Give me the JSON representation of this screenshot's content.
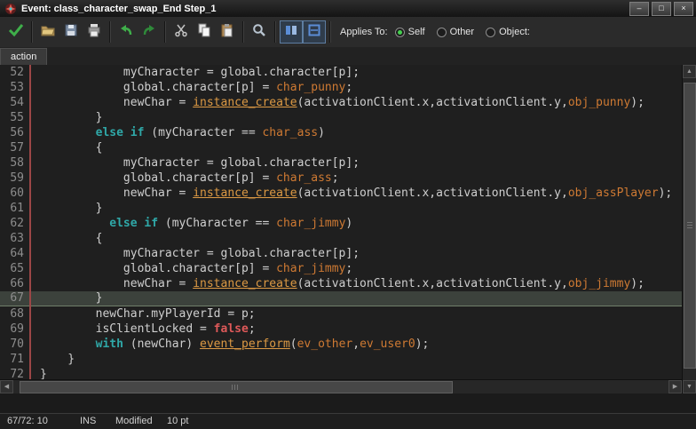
{
  "window": {
    "title": "Event: class_character_swap_End Step_1"
  },
  "glyphs": {
    "minimize": "–",
    "maximize": "□",
    "close": "×",
    "up": "▲",
    "down": "▼",
    "left": "◀",
    "right": "▶"
  },
  "toolbar": {
    "buttons": [
      "ok",
      "open",
      "save",
      "print",
      "undo",
      "redo",
      "cut",
      "copy",
      "paste",
      "search",
      "toggle-1",
      "toggle-2"
    ],
    "applies_to_label": "Applies To:",
    "radios": [
      {
        "label": "Self",
        "selected": true
      },
      {
        "label": "Other",
        "selected": false
      },
      {
        "label": "Object:",
        "selected": false
      }
    ]
  },
  "tabs": [
    {
      "label": "action",
      "active": true
    }
  ],
  "editor": {
    "first_line": 52,
    "last_line": 72,
    "current_line": 67,
    "lines": [
      {
        "n": 52,
        "segs": [
          [
            "p",
            "            myCharacter = global.character[p];"
          ]
        ]
      },
      {
        "n": 53,
        "segs": [
          [
            "p",
            "            global.character[p] = "
          ],
          [
            "r",
            "char_punny"
          ],
          [
            "p",
            ";"
          ]
        ]
      },
      {
        "n": 54,
        "segs": [
          [
            "p",
            "            newChar = "
          ],
          [
            "f",
            "instance_create"
          ],
          [
            "p",
            "(activationClient.x,activationClient.y,"
          ],
          [
            "r",
            "obj_punny"
          ],
          [
            "p",
            ");"
          ]
        ]
      },
      {
        "n": 55,
        "segs": [
          [
            "p",
            "        }"
          ]
        ]
      },
      {
        "n": 56,
        "segs": [
          [
            "p",
            "        "
          ],
          [
            "k",
            "else if"
          ],
          [
            "p",
            " (myCharacter == "
          ],
          [
            "r",
            "char_ass"
          ],
          [
            "p",
            ")"
          ]
        ]
      },
      {
        "n": 57,
        "segs": [
          [
            "p",
            "        {"
          ]
        ]
      },
      {
        "n": 58,
        "segs": [
          [
            "p",
            "            myCharacter = global.character[p];"
          ]
        ]
      },
      {
        "n": 59,
        "segs": [
          [
            "p",
            "            global.character[p] = "
          ],
          [
            "r",
            "char_ass"
          ],
          [
            "p",
            ";"
          ]
        ]
      },
      {
        "n": 60,
        "segs": [
          [
            "p",
            "            newChar = "
          ],
          [
            "f",
            "instance_create"
          ],
          [
            "p",
            "(activationClient.x,activationClient.y,"
          ],
          [
            "r",
            "obj_assPlayer"
          ],
          [
            "p",
            ");"
          ]
        ]
      },
      {
        "n": 61,
        "segs": [
          [
            "p",
            "        }"
          ]
        ]
      },
      {
        "n": 62,
        "segs": [
          [
            "p",
            "          "
          ],
          [
            "k",
            "else if"
          ],
          [
            "p",
            " (myCharacter == "
          ],
          [
            "r",
            "char_jimmy"
          ],
          [
            "p",
            ")"
          ]
        ]
      },
      {
        "n": 63,
        "segs": [
          [
            "p",
            "        {"
          ]
        ]
      },
      {
        "n": 64,
        "segs": [
          [
            "p",
            "            myCharacter = global.character[p];"
          ]
        ]
      },
      {
        "n": 65,
        "segs": [
          [
            "p",
            "            global.character[p] = "
          ],
          [
            "r",
            "char_jimmy"
          ],
          [
            "p",
            ";"
          ]
        ]
      },
      {
        "n": 66,
        "segs": [
          [
            "p",
            "            newChar = "
          ],
          [
            "f",
            "instance_create"
          ],
          [
            "p",
            "(activationClient.x,activationClient.y,"
          ],
          [
            "r",
            "obj_jimmy"
          ],
          [
            "p",
            ");"
          ]
        ]
      },
      {
        "n": 67,
        "segs": [
          [
            "p",
            "        }"
          ]
        ]
      },
      {
        "n": 68,
        "segs": [
          [
            "p",
            "        newChar.myPlayerId = p;"
          ]
        ]
      },
      {
        "n": 69,
        "segs": [
          [
            "p",
            "        isClientLocked = "
          ],
          [
            "b",
            "false"
          ],
          [
            "p",
            ";"
          ]
        ]
      },
      {
        "n": 70,
        "segs": [
          [
            "p",
            "        "
          ],
          [
            "k",
            "with"
          ],
          [
            "p",
            " (newChar) "
          ],
          [
            "f",
            "event_perform"
          ],
          [
            "p",
            "("
          ],
          [
            "r",
            "ev_other"
          ],
          [
            "p",
            ","
          ],
          [
            "r",
            "ev_user0"
          ],
          [
            "p",
            ");"
          ]
        ]
      },
      {
        "n": 71,
        "segs": [
          [
            "p",
            "    }"
          ]
        ]
      },
      {
        "n": 72,
        "segs": [
          [
            "p",
            "}"
          ]
        ]
      }
    ]
  },
  "statusbar": {
    "position": "67/72: 10",
    "mode": "INS",
    "state": "Modified",
    "font_size": "10 pt"
  },
  "colors": {
    "plain": "#cfcfcf",
    "keyword": "#2fa8a8",
    "resource": "#cf7a33",
    "function": "#dd9a44",
    "boolean": "#de5959",
    "current_line": "#3c423c",
    "gutter_rule": "#9c4646",
    "check_green": "#3fae4a"
  }
}
